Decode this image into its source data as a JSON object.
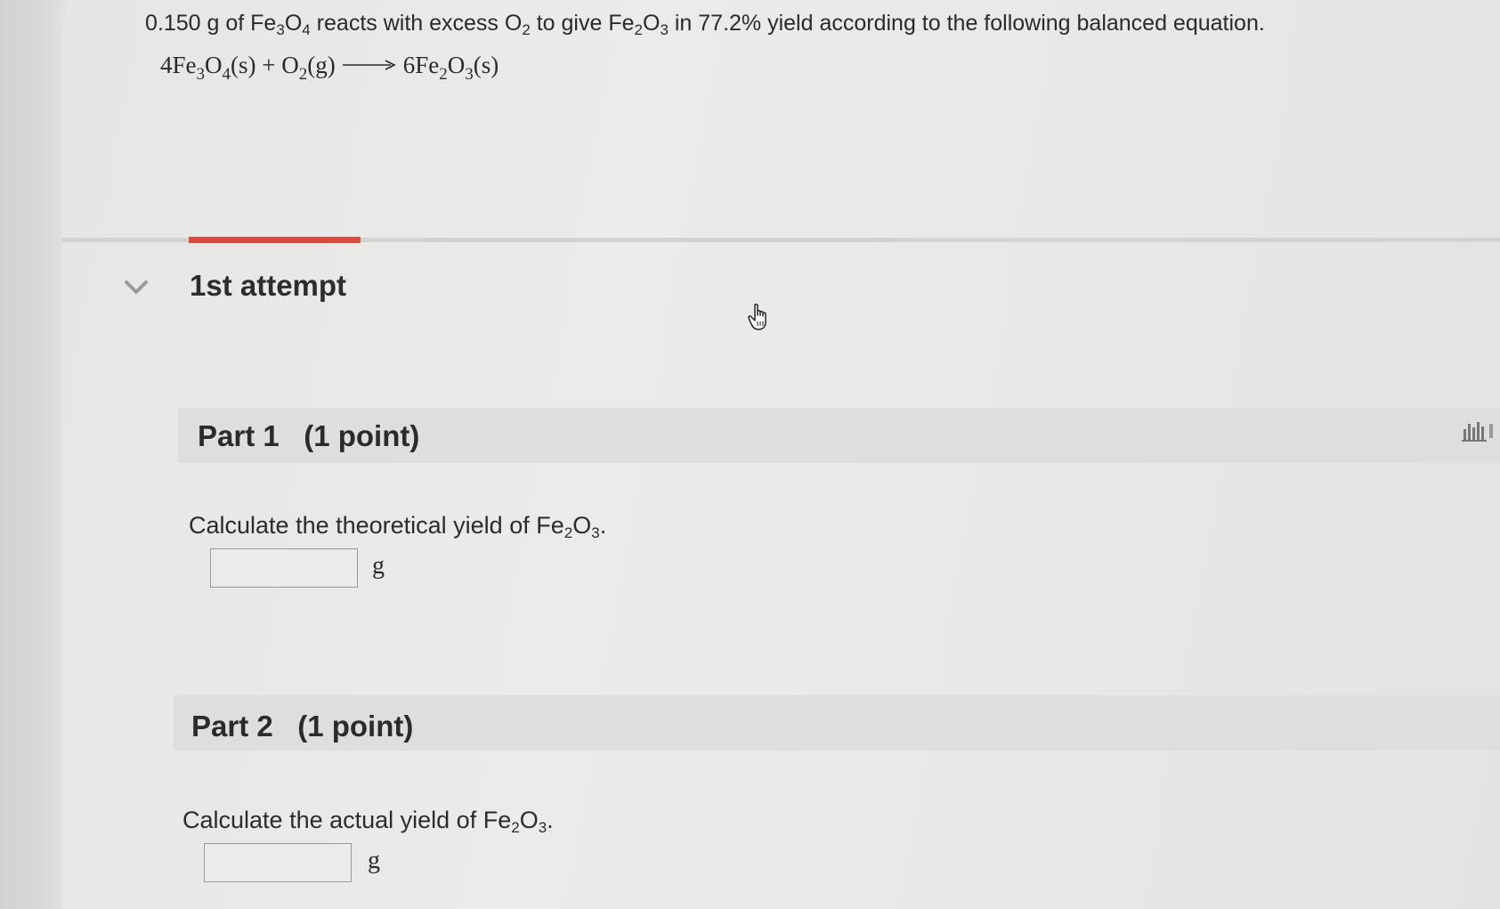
{
  "problem": {
    "amount": "0.150 g",
    "of_text": " of Fe",
    "sub_a": "3",
    "o_text": "O",
    "sub_b": "4",
    "reacts_text": " reacts with excess O",
    "sub_c": "2",
    "give_text": " to give Fe",
    "sub_d": "2",
    "o_text2": "O",
    "sub_e": "3",
    "tail_text": " in 77.2% yield according to the following balanced equation."
  },
  "equation": {
    "coef1": "4Fe",
    "s1": "3",
    "o1": "O",
    "s2": "4",
    "phase1": "(s) + O",
    "s3": "2",
    "phase2": "(g)",
    "coef2": "6Fe",
    "s4": "2",
    "o2": "O",
    "s5": "3",
    "phase3": "(s)"
  },
  "attempt": {
    "title": "1st attempt"
  },
  "parts": [
    {
      "title": "Part 1   (1 point)",
      "prompt_pre": "Calculate the theoretical yield of Fe",
      "sub1": "2",
      "prompt_mid": "O",
      "sub2": "3",
      "prompt_end": ".",
      "input_value": "",
      "unit": "g"
    },
    {
      "title": "Part 2   (1 point)",
      "prompt_pre": "Calculate the actual yield of Fe",
      "sub1": "2",
      "prompt_mid": "O",
      "sub2": "3",
      "prompt_end": ".",
      "input_value": "",
      "unit": "g"
    }
  ],
  "icons": {
    "chevron": "chevron-down-icon",
    "cursor": "hand-pointer-icon",
    "side": "feedback-icon"
  },
  "colors": {
    "active_tab": "#d94a3c",
    "band": "#dededd",
    "text": "#2b2b2b"
  }
}
